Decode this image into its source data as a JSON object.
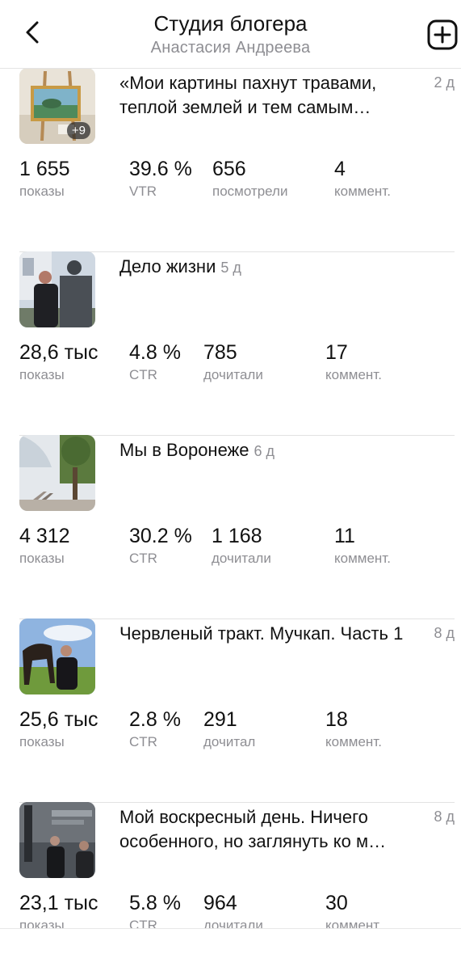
{
  "header": {
    "title": "Студия блогера",
    "subtitle": "Анастасия Андреева"
  },
  "posts": [
    {
      "title": "«Мои картины пахнут травами, теплой землей и тем самым…",
      "age": "2 д",
      "photo_count": "+9",
      "stats": [
        {
          "value": "1 655",
          "label": "показы"
        },
        {
          "value": "39.6 %",
          "label": "VTR"
        },
        {
          "value": "656",
          "label": "посмотрели"
        },
        {
          "value": "4",
          "label": "коммент."
        }
      ]
    },
    {
      "title": "Дело жизни",
      "age": "5 д",
      "stats": [
        {
          "value": "28,6 тыс",
          "label": "показы"
        },
        {
          "value": "4.8 %",
          "label": "CTR"
        },
        {
          "value": "785",
          "label": "дочитали"
        },
        {
          "value": "17",
          "label": "коммент."
        }
      ]
    },
    {
      "title": "Мы в Воронеже",
      "age": "6 д",
      "stats": [
        {
          "value": "4 312",
          "label": "показы"
        },
        {
          "value": "30.2 %",
          "label": "CTR"
        },
        {
          "value": "1 168",
          "label": "дочитали"
        },
        {
          "value": "11",
          "label": "коммент."
        }
      ]
    },
    {
      "title": "Червленый тракт. Мучкап. Часть 1",
      "age": "8 д",
      "stats": [
        {
          "value": "25,6 тыс",
          "label": "показы"
        },
        {
          "value": "2.8 %",
          "label": "CTR"
        },
        {
          "value": "291",
          "label": "дочитал"
        },
        {
          "value": "18",
          "label": "коммент."
        }
      ]
    },
    {
      "title": "Мой воскресный день. Ничего особенного, но заглянуть ко м…",
      "age": "8 д",
      "stats": [
        {
          "value": "23,1 тыс",
          "label": "показы"
        },
        {
          "value": "5.8 %",
          "label": "CTR"
        },
        {
          "value": "964",
          "label": "дочитали"
        },
        {
          "value": "30",
          "label": "коммент."
        }
      ]
    }
  ]
}
